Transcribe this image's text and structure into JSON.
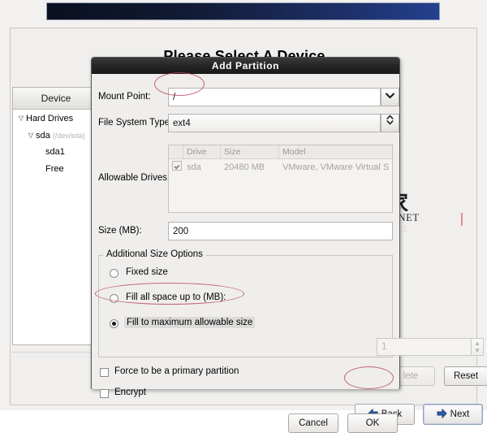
{
  "background": {
    "heading": "Please Select A Device",
    "tree": {
      "header": "Device",
      "rows": [
        {
          "label": "Hard Drives",
          "sub": "",
          "indent": 0,
          "twisty": "▽"
        },
        {
          "label": "sda",
          "sub": "(/dev/sda)",
          "indent": 1,
          "twisty": "▽"
        },
        {
          "label": "sda1",
          "sub": "",
          "indent": 2,
          "twisty": ""
        },
        {
          "label": "Free",
          "sub": "",
          "indent": 2,
          "twisty": ""
        }
      ]
    },
    "buttons": {
      "delete": "lete",
      "reset": "Reset",
      "back": "Back",
      "next": "Next"
    }
  },
  "watermark": {
    "cn": "系统之家",
    "en": "XITONGZHIJIA.NET",
    "logo_icon": "house-logo-icon",
    "logo_color": "#27a8d8"
  },
  "dialog": {
    "title": "Add Partition",
    "mount_point": {
      "label": "Mount Point:",
      "value": "/",
      "placeholder": "",
      "dropdown_icon": "chevron-down-icon"
    },
    "file_system_type": {
      "label": "File System Type:",
      "value": "ext4",
      "dropdown_icon": "updown-chevron-icon"
    },
    "allowable_drives": {
      "label": "Allowable Drives:",
      "columns": [
        "",
        "Drive",
        "Size",
        "Model"
      ],
      "rows": [
        {
          "checked": true,
          "drive": "sda",
          "size": "20480 MB",
          "model": "VMware, VMware Virtual S"
        }
      ]
    },
    "size": {
      "label": "Size (MB):",
      "value": "200"
    },
    "additional_size_options": {
      "legend": "Additional Size Options",
      "options": [
        {
          "label": "Fixed size",
          "selected": false
        },
        {
          "label": "Fill all space up to (MB):",
          "selected": false
        },
        {
          "label": "Fill to maximum allowable size",
          "selected": true
        }
      ],
      "spinner_value": "1",
      "spinner_up_icon": "spinner-up-icon",
      "spinner_down_icon": "spinner-down-icon"
    },
    "checkboxes": [
      {
        "label": "Force to be a primary partition",
        "checked": false
      },
      {
        "label": "Encrypt",
        "checked": false
      }
    ],
    "buttons": {
      "cancel": "Cancel",
      "ok": "OK"
    }
  },
  "colors": {
    "titlebar_start": "#0a1020",
    "titlebar_end": "#24408f",
    "dialog_titlebar": "#242424",
    "annotation_red": "#b4445a",
    "window_bg": "#efeeec"
  }
}
